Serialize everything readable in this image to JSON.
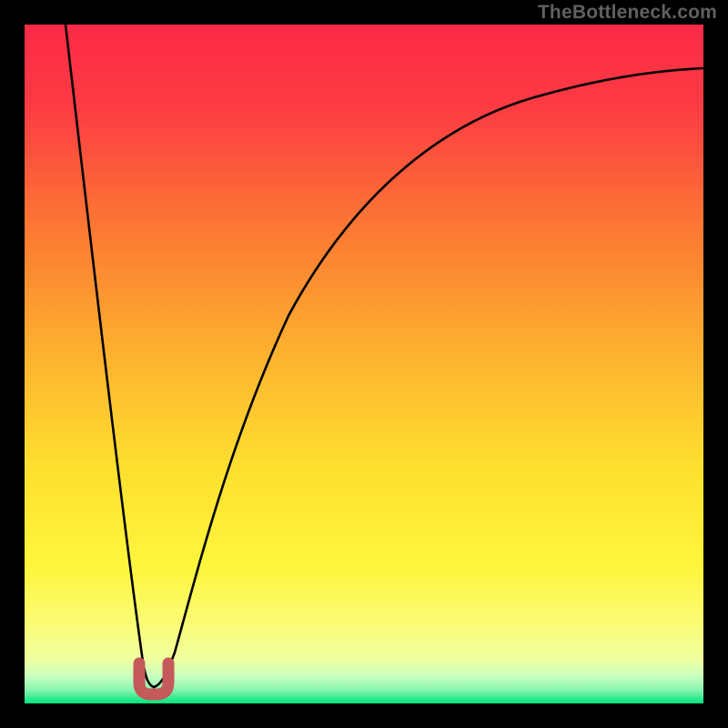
{
  "attribution": "TheBottleneck.com",
  "chart_data": {
    "type": "line",
    "title": "",
    "xlabel": "",
    "ylabel": "",
    "xlim": [
      0,
      100
    ],
    "ylim": [
      0,
      100
    ],
    "grid": false,
    "legend": false,
    "background_gradient": {
      "top": "#fd2a47",
      "mid_upper": "#fc8832",
      "mid": "#fedf2f",
      "mid_lower": "#fbf85e",
      "near_bottom": "#e2ffb1",
      "bottom": "#00e47c"
    },
    "curve": {
      "minimum_x": 19,
      "minimum_y": 2.5,
      "left_branch_top_x": 6,
      "right_branch_end_x": 100,
      "right_branch_end_y": 90
    },
    "marker": {
      "shape": "u",
      "x": 19,
      "y": 2.5,
      "color": "#c45a5a"
    }
  }
}
